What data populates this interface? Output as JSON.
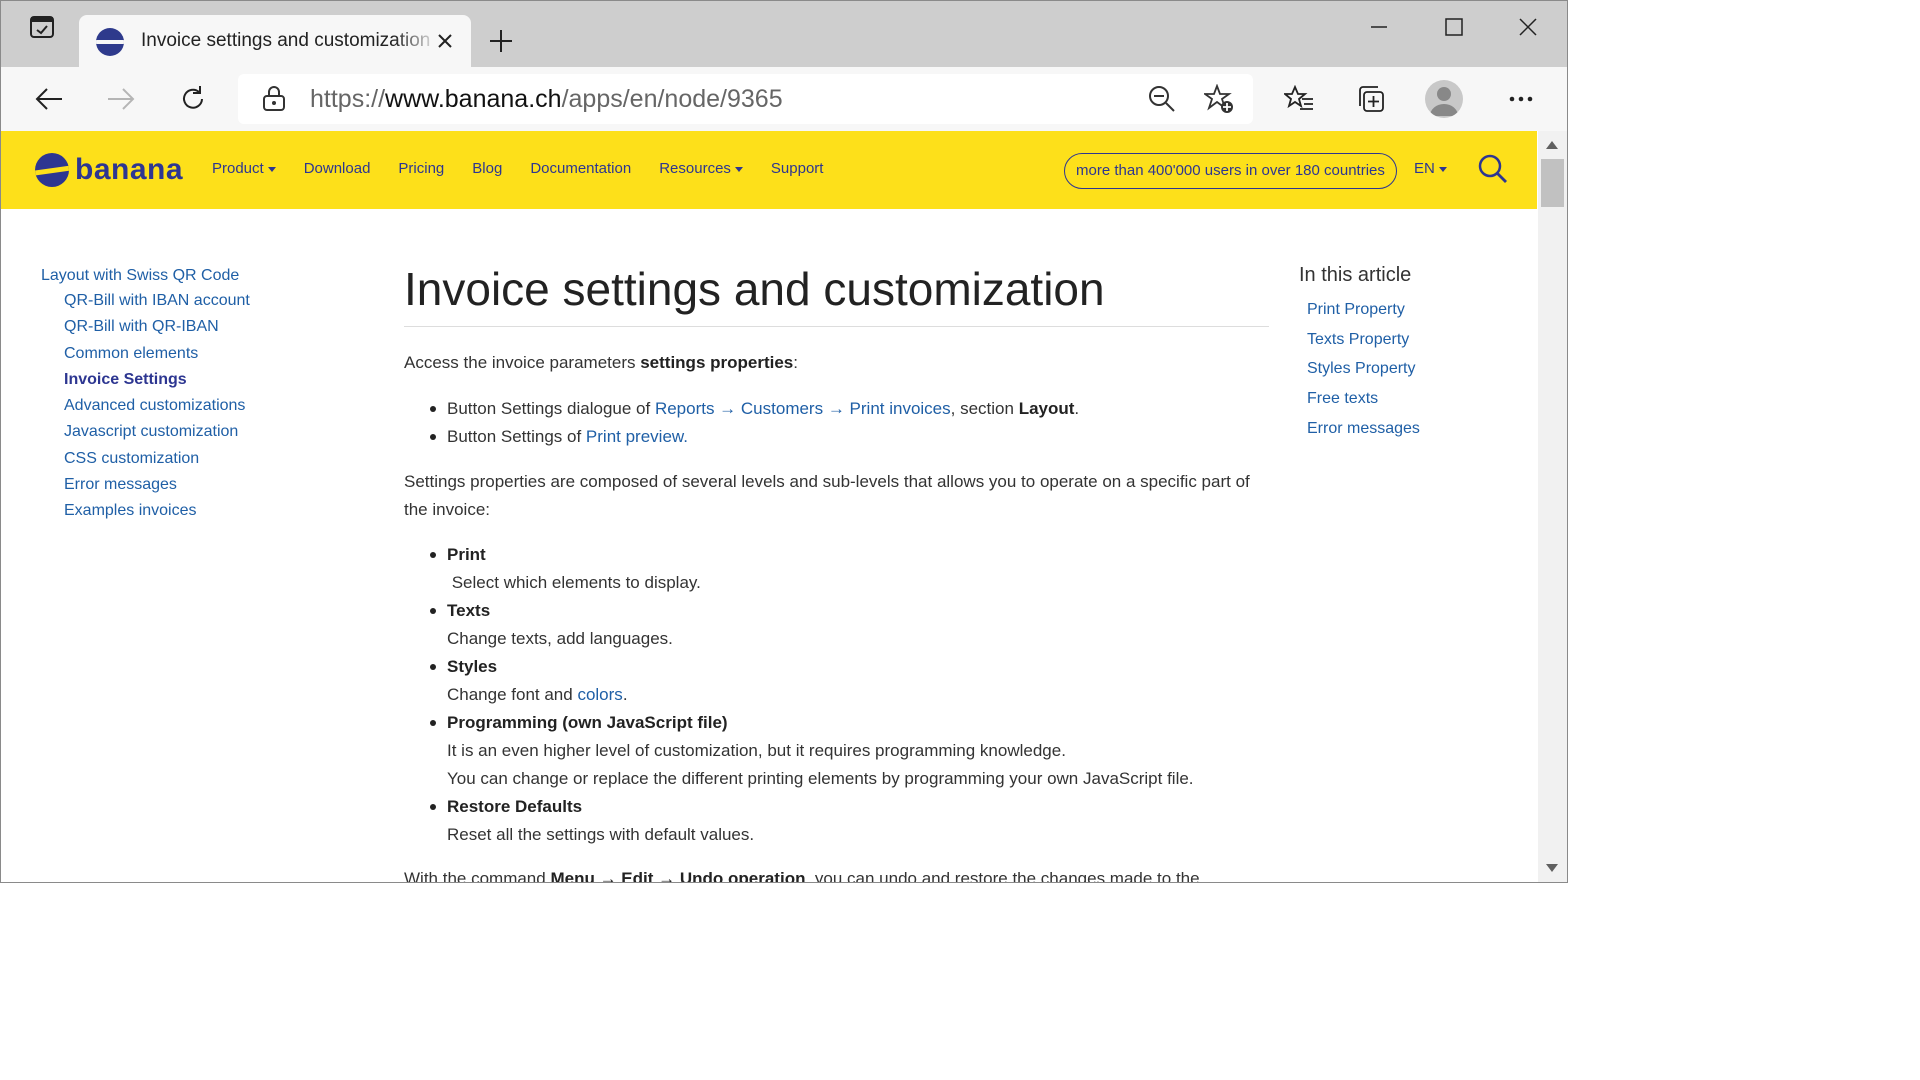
{
  "browser": {
    "tab": {
      "title": "Invoice settings and customization"
    },
    "url": {
      "scheme": "https://",
      "host": "www.banana.ch",
      "path": "/apps/en/node/9365"
    }
  },
  "header": {
    "logo_text": "banana",
    "nav": [
      "Product",
      "Download",
      "Pricing",
      "Blog",
      "Documentation",
      "Resources",
      "Support"
    ],
    "users_pill": "more than 400'000 users in over 180 countries",
    "language": "EN"
  },
  "sidebar": {
    "top": "Layout with Swiss QR Code",
    "items": [
      {
        "label": "QR-Bill with IBAN account"
      },
      {
        "label": "QR-Bill with QR-IBAN"
      },
      {
        "label": "Common elements"
      },
      {
        "label": "Invoice Settings"
      },
      {
        "label": "Advanced customizations"
      },
      {
        "label": "Javascript customization"
      },
      {
        "label": "CSS customization"
      },
      {
        "label": "Error messages"
      },
      {
        "label": "Examples invoices"
      }
    ]
  },
  "article": {
    "title": "Invoice settings and customization",
    "intro": {
      "pre": "Access the invoice parameters ",
      "bold": "settings properties",
      "post": ":"
    },
    "access": {
      "item1": {
        "pre": "Button Settings dialogue of ",
        "link": "Reports → Customers → Print invoices",
        "mid": ", section ",
        "bold": "Layout",
        "post": "."
      },
      "item2": {
        "pre": "Button Settings of ",
        "link": "Print preview."
      }
    },
    "levels_text": "Settings properties are composed of several levels and sub-levels that allows you to operate on a specific part of the invoice:",
    "levels": {
      "print": {
        "title": "Print",
        "desc": " Select which elements to display."
      },
      "texts": {
        "title": "Texts",
        "desc": "Change texts, add languages."
      },
      "styles": {
        "title": "Styles",
        "desc_pre": "Change font and ",
        "desc_link": "colors",
        "desc_post": "."
      },
      "programming": {
        "title": "Programming (own JavaScript file)",
        "desc1": "It is an even higher level of customization, but it requires programming knowledge.",
        "desc2": "You can change or replace the different printing elements by programming your own JavaScript file."
      },
      "restore": {
        "title": "Restore Defaults",
        "desc": "Reset all the settings with default values."
      }
    },
    "footer_partial": {
      "pre": "With the command ",
      "menu": "Menu",
      "arrow1": " → ",
      "edit": "Edit",
      "arrow2": " → ",
      "undo": "Undo operation",
      "post": ", you can undo and restore the changes made to the"
    }
  },
  "toc": {
    "title": "In this article",
    "items": [
      "Print Property",
      "Texts Property",
      "Styles Property",
      "Free texts",
      "Error messages"
    ]
  },
  "colors": {
    "brand_yellow": "#fde01a",
    "brand_blue": "#2d3691",
    "link": "#1f5fa6"
  }
}
